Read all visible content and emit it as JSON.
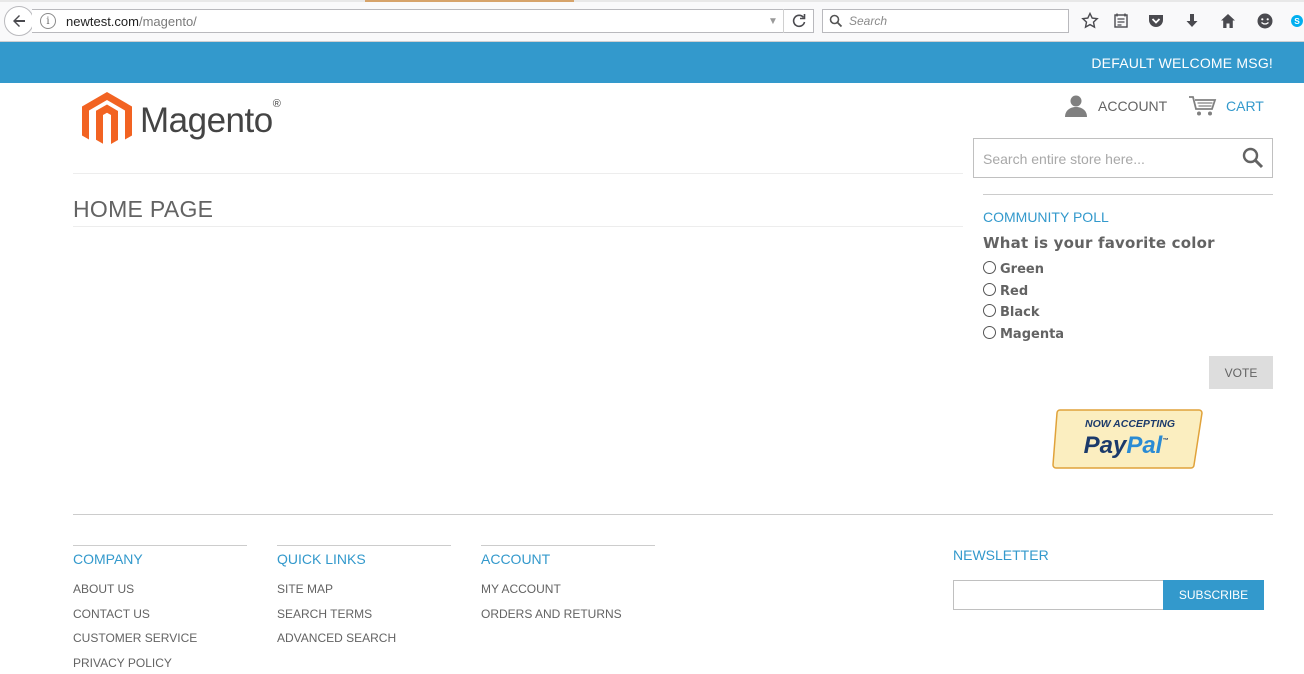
{
  "browser": {
    "url_host": "newtest.com",
    "url_path": "/magento/",
    "search_placeholder": "Search"
  },
  "header": {
    "welcome": "DEFAULT WELCOME MSG!",
    "logo_text": "Magento",
    "logo_reg": "®",
    "account_label": "ACCOUNT",
    "cart_label": "CART",
    "search_placeholder": "Search entire store here..."
  },
  "main": {
    "title": "HOME PAGE"
  },
  "poll": {
    "heading": "COMMUNITY POLL",
    "question": "What is your favorite color",
    "options": [
      "Green",
      "Red",
      "Black",
      "Magenta"
    ],
    "vote_label": "VOTE"
  },
  "paypal": {
    "line1": "NOW ACCEPTING",
    "line2a": "Pay",
    "line2b": "Pal",
    "tm": "™"
  },
  "footer": {
    "columns": [
      {
        "heading": "COMPANY",
        "links": [
          "ABOUT US",
          "CONTACT US",
          "CUSTOMER SERVICE",
          "PRIVACY POLICY"
        ]
      },
      {
        "heading": "QUICK LINKS",
        "links": [
          "SITE MAP",
          "SEARCH TERMS",
          "ADVANCED SEARCH"
        ]
      },
      {
        "heading": "ACCOUNT",
        "links": [
          "MY ACCOUNT",
          "ORDERS AND RETURNS"
        ]
      }
    ],
    "newsletter": {
      "heading": "NEWSLETTER",
      "subscribe_label": "SUBSCRIBE"
    }
  },
  "colors": {
    "accent": "#3399cc",
    "text": "#636363",
    "logo_orange": "#f26322"
  },
  "icons": [
    "back-arrow-icon",
    "info-icon",
    "dropdown-arrow-icon",
    "reload-icon",
    "search-icon",
    "bookmark-star-icon",
    "reading-list-icon",
    "pocket-icon",
    "download-icon",
    "home-icon",
    "smiley-icon",
    "skype-icon",
    "user-icon",
    "cart-icon",
    "magento-logo-icon"
  ]
}
